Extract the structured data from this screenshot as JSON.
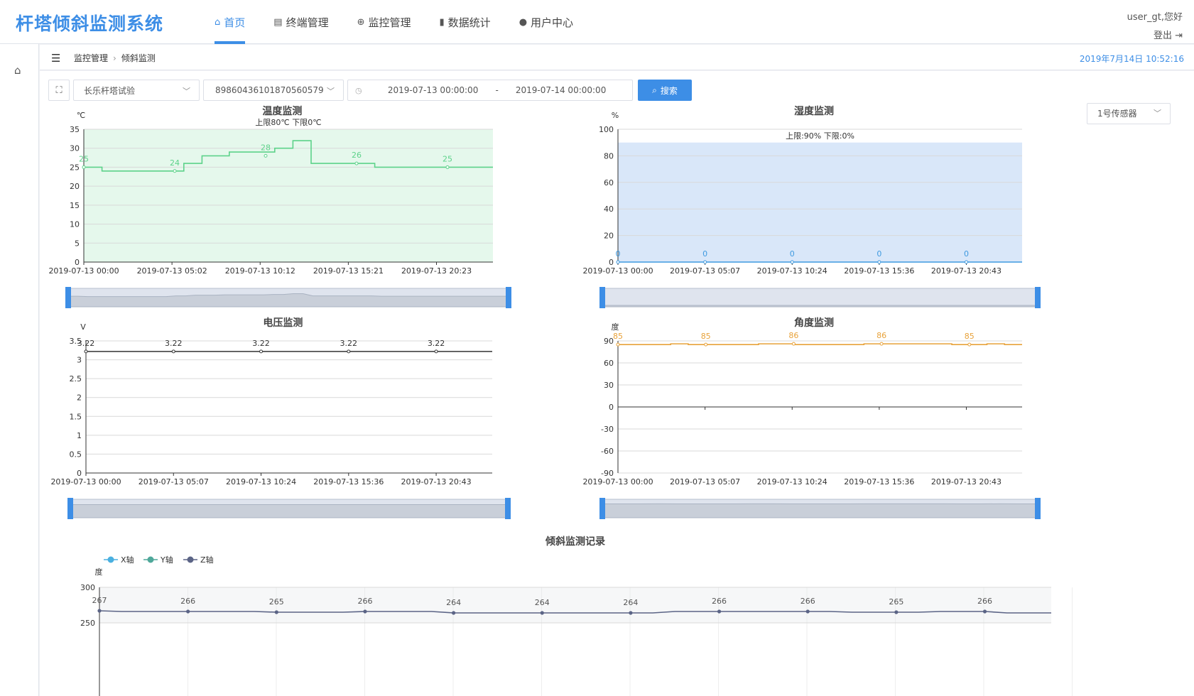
{
  "header": {
    "brand": "杆塔倾斜监测系统",
    "nav": [
      {
        "label": "首页",
        "icon": "home-icon",
        "active": true
      },
      {
        "label": "终端管理",
        "icon": "terminal-icon",
        "active": false
      },
      {
        "label": "监控管理",
        "icon": "globe-icon",
        "active": false
      },
      {
        "label": "数据统计",
        "icon": "bar-chart-icon",
        "active": false
      },
      {
        "label": "用户中心",
        "icon": "user-icon",
        "active": false
      }
    ],
    "greeting": "user_gt,您好",
    "logout": "登出"
  },
  "breadcrumb": [
    "监控管理",
    "倾斜监测"
  ],
  "datetime": "2019年7月14日 10:52:16",
  "filters": {
    "site": "长乐杆塔试验",
    "device": "89860436101870560579",
    "start": "2019-07-13 00:00:00",
    "dash": "-",
    "end": "2019-07-14 00:00:00",
    "search_label": "搜索"
  },
  "sensor_select": "1号传感器",
  "colors": {
    "accent": "#3d8ee6",
    "temperature": "#5dd28a",
    "humidity": "#3f9ae0",
    "voltage": "#333333",
    "angle": "#e8a23a",
    "z_axis": "#5b6486"
  },
  "chart_data": [
    {
      "type": "line",
      "title": "温度监测",
      "subtitle": "上限80℃ 下限0℃",
      "ylabel": "℃",
      "ylim": [
        0,
        35
      ],
      "yticks": [
        0,
        5,
        10,
        15,
        20,
        25,
        30,
        35
      ],
      "xticks": [
        "2019-07-13 00:00",
        "2019-07-13 05:02",
        "2019-07-13 10:12",
        "2019-07-13 15:21",
        "2019-07-13 20:23"
      ],
      "series": [
        {
          "values": [
            25,
            25,
            24,
            24,
            24,
            24,
            24,
            24,
            24,
            24,
            24,
            26,
            26,
            28,
            28,
            28,
            29,
            29,
            29,
            29,
            29,
            30,
            30,
            32,
            32,
            26,
            26,
            26,
            26,
            26,
            26,
            26,
            25,
            25,
            25,
            25,
            25,
            25,
            25,
            25,
            25,
            25,
            25,
            25,
            25,
            25
          ]
        }
      ],
      "point_labels": [
        {
          "x": 0,
          "y": 25,
          "label": "25"
        },
        {
          "x": 10,
          "y": 24,
          "label": "24"
        },
        {
          "x": 20,
          "y": 28,
          "label": "28"
        },
        {
          "x": 30,
          "y": 26,
          "label": "26"
        },
        {
          "x": 40,
          "y": 25,
          "label": "25"
        }
      ]
    },
    {
      "type": "area",
      "title": "湿度监测",
      "subtitle": "上限:90% 下限:0%",
      "ylabel": "%",
      "ylim": [
        0,
        100
      ],
      "yticks": [
        0,
        20,
        40,
        60,
        80,
        100
      ],
      "band": [
        0,
        90
      ],
      "xticks": [
        "2019-07-13 00:00",
        "2019-07-13 05:07",
        "2019-07-13 10:24",
        "2019-07-13 15:36",
        "2019-07-13 20:43"
      ],
      "series": [
        {
          "values": [
            0,
            0,
            0,
            0,
            0,
            0
          ]
        }
      ],
      "point_labels": [
        {
          "x": 0,
          "y": 0,
          "label": "0"
        },
        {
          "x": 1,
          "y": 0,
          "label": "0"
        },
        {
          "x": 2,
          "y": 0,
          "label": "0"
        },
        {
          "x": 3,
          "y": 0,
          "label": "0"
        },
        {
          "x": 4,
          "y": 0,
          "label": "0"
        }
      ]
    },
    {
      "type": "line",
      "title": "电压监测",
      "ylabel": "V",
      "ylim": [
        0,
        3.5
      ],
      "yticks": [
        0,
        0.5,
        1,
        1.5,
        2,
        2.5,
        3,
        3.5
      ],
      "xticks": [
        "2019-07-13 00:00",
        "2019-07-13 05:07",
        "2019-07-13 10:24",
        "2019-07-13 15:36",
        "2019-07-13 20:43"
      ],
      "series": [
        {
          "values": [
            3.22,
            3.22,
            3.22,
            3.22,
            3.22,
            3.22
          ]
        }
      ],
      "point_labels": [
        {
          "x": 0,
          "y": 3.22,
          "label": "3.22"
        },
        {
          "x": 1,
          "y": 3.22,
          "label": "3.22"
        },
        {
          "x": 2,
          "y": 3.22,
          "label": "3.22"
        },
        {
          "x": 3,
          "y": 3.22,
          "label": "3.22"
        },
        {
          "x": 4,
          "y": 3.22,
          "label": "3.22"
        }
      ]
    },
    {
      "type": "line",
      "title": "角度监测",
      "ylabel": "度",
      "ylim": [
        -90,
        90
      ],
      "yticks": [
        -90,
        -60,
        -30,
        0,
        30,
        60,
        90
      ],
      "xticks": [
        "2019-07-13 00:00",
        "2019-07-13 05:07",
        "2019-07-13 10:24",
        "2019-07-13 15:36",
        "2019-07-13 20:43"
      ],
      "series": [
        {
          "values": [
            85,
            85,
            85,
            86,
            85,
            85,
            85,
            85,
            86,
            86,
            85,
            85,
            85,
            85,
            86,
            86,
            86,
            86,
            86,
            85,
            85,
            86,
            85,
            85
          ]
        }
      ],
      "point_labels": [
        {
          "x": 0,
          "y": 85,
          "label": "85"
        },
        {
          "x": 5,
          "y": 85,
          "label": "85"
        },
        {
          "x": 10,
          "y": 86,
          "label": "86"
        },
        {
          "x": 15,
          "y": 86,
          "label": "86"
        },
        {
          "x": 20,
          "y": 85,
          "label": "85"
        }
      ]
    },
    {
      "type": "line",
      "title": "倾斜监测记录",
      "legend": [
        "X轴",
        "Y轴",
        "Z轴"
      ],
      "ylabel": "度",
      "ylim": [
        200,
        300
      ],
      "yticks": [
        250,
        300
      ],
      "series": [
        {
          "name": "Z轴",
          "values": [
            267,
            266,
            266,
            266,
            266,
            266,
            266,
            266,
            265,
            265,
            265,
            265,
            266,
            266,
            266,
            266,
            264,
            264,
            264,
            264,
            264,
            264,
            264,
            264,
            264,
            264,
            266,
            266,
            266,
            266,
            266,
            266,
            266,
            266,
            265,
            265,
            265,
            265,
            266,
            266,
            266,
            264,
            264,
            264
          ]
        }
      ],
      "point_labels": [
        {
          "x": 0,
          "y": 267,
          "label": "267"
        },
        {
          "x": 4,
          "y": 266,
          "label": "266"
        },
        {
          "x": 8,
          "y": 265,
          "label": "265"
        },
        {
          "x": 12,
          "y": 266,
          "label": "266"
        },
        {
          "x": 16,
          "y": 264,
          "label": "264"
        },
        {
          "x": 20,
          "y": 264,
          "label": "264"
        },
        {
          "x": 24,
          "y": 264,
          "label": "264"
        },
        {
          "x": 28,
          "y": 266,
          "label": "266"
        },
        {
          "x": 32,
          "y": 266,
          "label": "266"
        },
        {
          "x": 36,
          "y": 265,
          "label": "265"
        },
        {
          "x": 40,
          "y": 266,
          "label": "266"
        }
      ]
    }
  ]
}
